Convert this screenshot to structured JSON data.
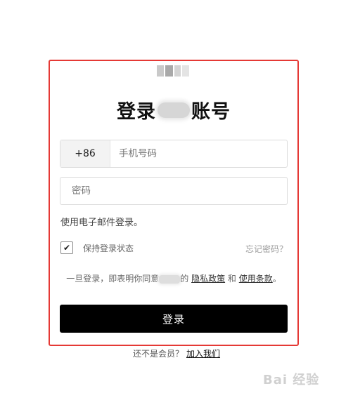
{
  "form": {
    "title_prefix": "登录",
    "title_suffix": "账号",
    "country_code": "+86",
    "phone_placeholder": "手机号码",
    "password_placeholder": "密码",
    "email_login_link": "使用电子邮件登录。",
    "remember_label": "保持登录状态",
    "remember_checked": true,
    "forgot_link": "忘记密码？",
    "terms_prefix": "一旦登录，即表明你同意",
    "terms_connector_partial": "的",
    "privacy_link": "隐私政策",
    "terms_and": "和",
    "terms_link": "使用条款",
    "terms_end": "。",
    "login_button": "登录"
  },
  "footer": {
    "not_member": "还不是会员？",
    "join_link": "加入我们"
  },
  "watermark": {
    "text": "Bai 经验"
  },
  "colors": {
    "highlight_border": "#e53935",
    "button_bg": "#000000",
    "country_bg": "#f3f3f3"
  },
  "icons": {
    "checkmark": "check-icon"
  }
}
